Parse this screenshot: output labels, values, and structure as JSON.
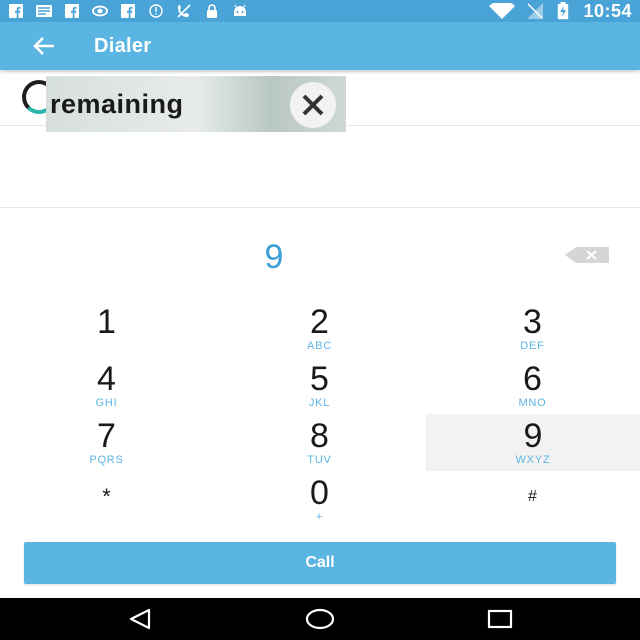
{
  "status_bar": {
    "time": "10:54",
    "left_icons": [
      "facebook-icon",
      "message-icon",
      "facebook-icon",
      "nvidia-icon",
      "facebook-icon",
      "info-icon",
      "no-call-icon",
      "lock-icon",
      "android-icon"
    ],
    "right_icons": [
      "wifi-icon",
      "no-signal-icon",
      "battery-charging-icon"
    ]
  },
  "toolbar": {
    "title": "Dialer",
    "back_icon": "arrow-back-icon"
  },
  "banner": {
    "text": "remaining",
    "close_icon": "close-icon"
  },
  "display": {
    "number": "9",
    "backspace_icon": "backspace-icon"
  },
  "keypad": [
    {
      "digit": "1",
      "letters": ""
    },
    {
      "digit": "2",
      "letters": "ABC"
    },
    {
      "digit": "3",
      "letters": "DEF"
    },
    {
      "digit": "4",
      "letters": "GHI"
    },
    {
      "digit": "5",
      "letters": "JKL"
    },
    {
      "digit": "6",
      "letters": "MNO"
    },
    {
      "digit": "7",
      "letters": "PQRS"
    },
    {
      "digit": "8",
      "letters": "TUV"
    },
    {
      "digit": "9",
      "letters": "WXYZ"
    },
    {
      "digit": "*",
      "letters": ""
    },
    {
      "digit": "0",
      "letters": "+"
    },
    {
      "digit": "#",
      "letters": ""
    }
  ],
  "call_button": {
    "label": "Call"
  },
  "nav_bar": {
    "back_icon": "nav-back-icon",
    "home_icon": "nav-home-icon",
    "recents_icon": "nav-recents-icon"
  },
  "colors": {
    "status_bar": "#4aa3d6",
    "toolbar": "#5bb5e2",
    "accent_number": "#3a9fd6",
    "call_button": "#5bb5e2"
  }
}
